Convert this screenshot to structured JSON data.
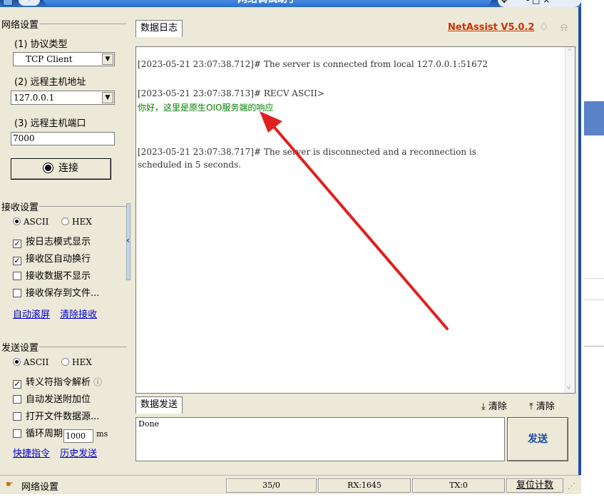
{
  "window": {
    "title": "网络调试助手",
    "sys_buttons": "-  □  ×"
  },
  "network": {
    "legend": "网络设置",
    "protocol_label": "(1) 协议类型",
    "protocol_value": "TCP Client",
    "host_label": "(2) 远程主机地址",
    "host_value": "127.0.0.1",
    "port_label": "(3) 远程主机端口",
    "port_value": "7000",
    "connect_label": "连接"
  },
  "receive": {
    "legend": "接收设置",
    "ascii": "ASCII",
    "hex": "HEX",
    "options": [
      "按日志模式显示",
      "接收区自动换行",
      "接收数据不显示",
      "接收保存到文件..."
    ],
    "checked": [
      true,
      true,
      false,
      false
    ],
    "link1": "自动滚屏",
    "link2": "清除接收"
  },
  "send": {
    "legend": "发送设置",
    "ascii": "ASCII",
    "hex": "HEX",
    "options": [
      "转义符指令解析",
      "自动发送附加位",
      "打开文件数据源...",
      "循环周期"
    ],
    "checked": [
      true,
      false,
      false,
      false
    ],
    "info_icon": "ⓘ",
    "period_value": "1000",
    "period_unit": "ms",
    "link1": "快捷指令",
    "link2": "历史发送"
  },
  "log": {
    "tab": "数据日志",
    "brand": "NetAssist V5.0.2",
    "lines": [
      {
        "text": "[2023-05-21 23:07:38.712]# The server is connected from local 127.0.0.1:51672",
        "color": "#333333"
      },
      {
        "text": "[2023-05-21 23:07:38.713]# RECV ASCII>",
        "color": "#333333"
      },
      {
        "text": "你好，这里是原生OIO服务端的响应",
        "color": "#008000"
      },
      {
        "text": "[2023-05-21 23:07:38.717]# The server is disconnected and a reconnection is",
        "color": "#333333"
      },
      {
        "text": "scheduled in 5 seconds.",
        "color": "#333333"
      }
    ]
  },
  "sendbox": {
    "tab": "数据发送",
    "clear1": "清除",
    "clear2": "清除",
    "content": "Done",
    "send_button": "发送"
  },
  "statusbar": {
    "label": "网络设置",
    "count": "35/0",
    "rx": "RX:1645",
    "tx": "TX:0",
    "reset": "复位计数"
  },
  "colors": {
    "title_blue": "#2f71c9",
    "brand_red": "#cc3300",
    "recv_green": "#008000",
    "link_blue": "#0000cc",
    "arrow_red": "#e02020"
  }
}
